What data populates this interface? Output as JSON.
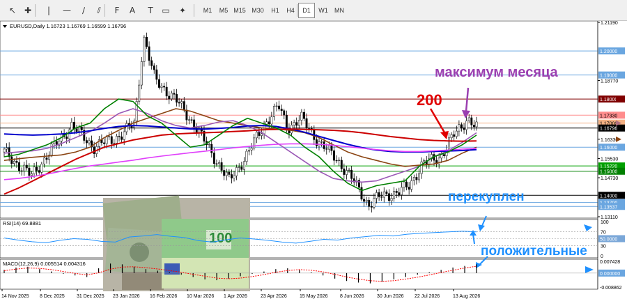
{
  "toolbar": {
    "icons": [
      "cursor-icon",
      "crosshair-icon",
      "vertical-line-icon",
      "horizontal-line-icon",
      "trendline-icon",
      "equidistant-channel-icon",
      "fibonacci-icon",
      "text-icon",
      "text-label-icon",
      "rectangle-icon",
      "shapes-icon"
    ],
    "timeframes": [
      "M1",
      "M5",
      "M15",
      "M30",
      "H1",
      "H4",
      "D1",
      "W1",
      "MN"
    ],
    "active_timeframe": "D1"
  },
  "chart_data": [
    {
      "type": "candlestick",
      "header": "EURUSD,Daily  1.16723 1.16769 1.16599 1.16796",
      "symbol": "EURUSD",
      "timeframe": "Daily",
      "ohlc_readout": [
        "1.16723",
        "1.16769",
        "1.16599",
        "1.16796"
      ],
      "x_tick_labels": [
        "14 Nov 2025",
        "8 Dec 2025",
        "31 Dec 2025",
        "23 Jan 2026",
        "16 Feb 2026",
        "10 Mar 2026",
        "1 Apr 2026",
        "23 Apr 2026",
        "15 May 2026",
        "8 Jun 2026",
        "30 Jun 2026",
        "22 Jul 2026",
        "13 Aug 2026"
      ],
      "y_tick_labels": [
        "1.21190",
        "1.20000",
        "1.19000",
        "1.18770",
        "1.18000",
        "1.17330",
        "1.17000",
        "1.16796",
        "1.16330",
        "1.16000",
        "1.15530",
        "1.15220",
        "1.15000",
        "1.14730",
        "1.14000",
        "1.13700",
        "1.13537",
        "1.13110"
      ],
      "ylim": [
        1.1311,
        1.2119
      ],
      "price_levels": [
        {
          "label": "1.20000",
          "value": 1.2,
          "color": "#6aa6e0"
        },
        {
          "label": "1.19000",
          "value": 1.19,
          "color": "#6aa6e0"
        },
        {
          "label": "1.18000",
          "value": 1.18,
          "color": "#800000"
        },
        {
          "label": "1.17330",
          "value": 1.1733,
          "color": "#ff8c8c"
        },
        {
          "label": "1.17000",
          "value": 1.17,
          "color": "#f4b183"
        },
        {
          "label": "1.16796",
          "value": 1.16796,
          "color": "#000000"
        },
        {
          "label": "1.16000",
          "value": 1.16,
          "color": "#6aa6e0"
        },
        {
          "label": "1.15220",
          "value": 1.1522,
          "color": "#00a000"
        },
        {
          "label": "1.15000",
          "value": 1.15,
          "color": "#008000"
        },
        {
          "label": "1.14000",
          "value": 1.14,
          "color": "#000000"
        },
        {
          "label": "1.13700",
          "value": 1.137,
          "color": "#6aa6e0"
        },
        {
          "label": "1.13537",
          "value": 1.13537,
          "color": "#6aa6e0"
        }
      ],
      "series": [
        {
          "color": "#8B4513",
          "values": [
            1.1545,
            1.1552,
            1.1558,
            1.1563,
            1.1568,
            1.158,
            1.16,
            1.164,
            1.167,
            1.17,
            1.172,
            1.174,
            1.176,
            1.175,
            1.173,
            1.171,
            1.17,
            1.169,
            1.168,
            1.1675,
            1.167,
            1.166,
            1.164,
            1.161,
            1.158,
            1.156,
            1.1545,
            1.153,
            1.152,
            1.1525,
            1.153,
            1.1545,
            1.1575,
            1.16
          ]
        },
        {
          "color": "#9b59b6",
          "values": [
            1.1575,
            1.158,
            1.1585,
            1.1595,
            1.1615,
            1.164,
            1.1665,
            1.17,
            1.174,
            1.176,
            1.174,
            1.171,
            1.169,
            1.168,
            1.169,
            1.1705,
            1.171,
            1.169,
            1.166,
            1.162,
            1.158,
            1.154,
            1.15,
            1.147,
            1.146,
            1.1455,
            1.146,
            1.148,
            1.15,
            1.152,
            1.156,
            1.1585,
            1.162,
            1.166
          ]
        },
        {
          "color": "#0000cc",
          "values": [
            1.1655,
            1.1652,
            1.165,
            1.1652,
            1.1655,
            1.166,
            1.1668,
            1.1678,
            1.1686,
            1.169,
            1.1688,
            1.1684,
            1.168,
            1.1676,
            1.1675,
            1.1678,
            1.1682,
            1.1688,
            1.169,
            1.1686,
            1.1676,
            1.1662,
            1.1645,
            1.1628,
            1.1612,
            1.1598,
            1.1588,
            1.1582,
            1.158,
            1.158,
            1.1582,
            1.1584,
            1.1586,
            1.159
          ]
        },
        {
          "color": "#cc0000",
          "values": [
            1.1405,
            1.143,
            1.146,
            1.149,
            1.152,
            1.155,
            1.1575,
            1.16,
            1.1615,
            1.163,
            1.164,
            1.165,
            1.1655,
            1.1658,
            1.166,
            1.1662,
            1.1665,
            1.1668,
            1.1672,
            1.1674,
            1.1675,
            1.1674,
            1.1672,
            1.167,
            1.1666,
            1.166,
            1.1652,
            1.1644,
            1.1638,
            1.1632,
            1.1628,
            1.1626,
            1.1625,
            1.1626
          ]
        },
        {
          "color": "#e040fb",
          "values": [
            1.1465,
            1.147,
            1.1478,
            1.1488,
            1.15,
            1.1512,
            1.1522,
            1.153,
            1.1538,
            1.1546,
            1.1555,
            1.1563,
            1.157,
            1.1577,
            1.1583,
            1.159,
            1.1597,
            1.1603,
            1.1608,
            1.1612,
            1.1614,
            1.1614,
            1.1612,
            1.1608,
            1.1602,
            1.1596,
            1.159,
            1.1585,
            1.1582,
            1.1582,
            1.1585,
            1.1588,
            1.1592,
            1.1595
          ]
        },
        {
          "color": "#008000",
          "values": [
            1.156,
            1.157,
            1.159,
            1.161,
            1.164,
            1.168,
            1.17,
            1.176,
            1.18,
            1.179,
            1.173,
            1.17,
            1.165,
            1.16,
            1.161,
            1.165,
            1.169,
            1.172,
            1.17,
            1.168,
            1.165,
            1.16,
            1.156,
            1.15,
            1.145,
            1.142,
            1.144,
            1.145,
            1.146,
            1.152,
            1.156,
            1.158,
            1.161,
            1.165
          ]
        }
      ],
      "annotations": [
        {
          "text": "максимум месяца",
          "color": "#9b3fb0"
        },
        {
          "text": "200",
          "color": "#e00000"
        },
        {
          "text": "перекуплен",
          "color": "#1e90ff"
        },
        {
          "text": "положительные",
          "color": "#1e90ff"
        }
      ],
      "background_image": "dollar-euro-banknotes-photo"
    },
    {
      "type": "line",
      "header": "RSI(14) 69.8881",
      "indicator": "RSI",
      "period": 14,
      "value": 69.8881,
      "y_tick_labels": [
        "100",
        "70",
        "50.0000",
        "30",
        "0"
      ],
      "ylim": [
        0,
        100
      ],
      "levels": [
        70,
        50,
        30
      ],
      "color": "#1e90ff",
      "values": [
        52,
        46,
        41,
        38,
        45,
        50,
        48,
        42,
        40,
        55,
        58,
        62,
        57,
        53,
        44,
        40,
        47,
        52,
        49,
        45,
        40,
        37,
        42,
        48,
        46,
        52,
        56,
        60,
        58,
        63,
        66,
        68,
        70,
        72,
        69.9
      ]
    },
    {
      "type": "bar",
      "header": "MACD(12,26,9) 0.005514 0.004316",
      "indicator": "MACD",
      "params": [
        12,
        26,
        9
      ],
      "values_readout": [
        0.005514,
        0.004316
      ],
      "y_tick_labels": [
        "0.007428",
        "0.000000",
        "-0.008862"
      ],
      "ylim": [
        -0.008862,
        0.007428
      ],
      "hist_color": "#000000",
      "signal_color": "#ff0000",
      "hist": [
        0.002,
        0.0035,
        0.004,
        0.0025,
        0.001,
        -0.0005,
        -0.0015,
        -0.0025,
        0.003,
        0.006,
        0.0055,
        0.004,
        0.0025,
        0.0015,
        0.0005,
        -0.001,
        -0.0025,
        -0.004,
        -0.0045,
        -0.0035,
        -0.002,
        -0.0005,
        0.001,
        0.0025,
        0.003,
        0.002,
        0.0005,
        -0.0015,
        -0.0035,
        -0.005,
        -0.006,
        -0.0065,
        -0.0055,
        -0.004,
        -0.0025,
        -0.001,
        0.0005,
        0.002,
        0.0035,
        0.0045,
        0.0055
      ],
      "signal": [
        0.0015,
        0.0025,
        0.0032,
        0.003,
        0.0022,
        0.001,
        -0.0002,
        -0.0012,
        0.0002,
        0.0025,
        0.0038,
        0.004,
        0.0034,
        0.0026,
        0.0016,
        0.0005,
        -0.0008,
        -0.002,
        -0.0032,
        -0.0036,
        -0.0032,
        -0.0022,
        -0.001,
        0.0005,
        0.0016,
        0.0022,
        0.0018,
        0.0008,
        -0.0008,
        -0.0025,
        -0.0038,
        -0.0048,
        -0.0052,
        -0.0048,
        -0.0038,
        -0.0026,
        -0.0012,
        0.0004,
        0.0018,
        0.0032,
        0.0043
      ]
    }
  ]
}
